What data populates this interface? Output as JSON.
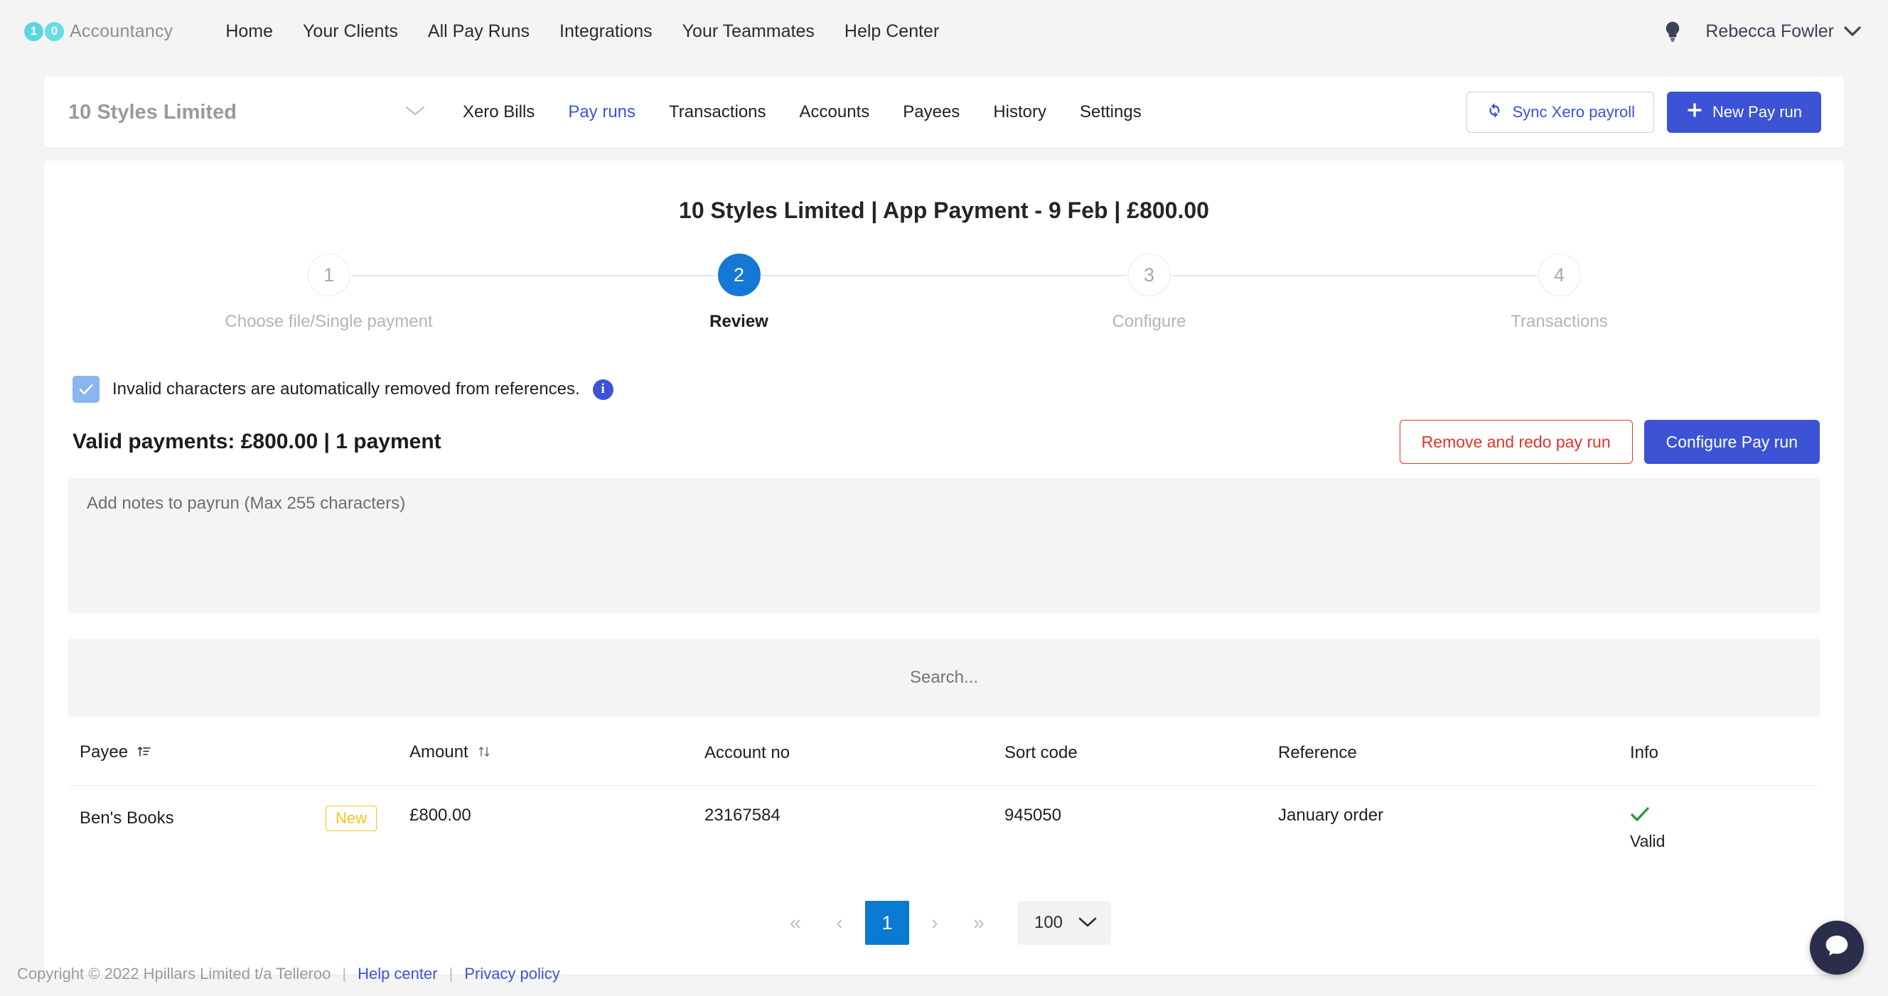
{
  "header": {
    "brand": {
      "digit_one": "1",
      "digit_zero": "0",
      "name": "Accountancy"
    },
    "nav": [
      {
        "label": "Home"
      },
      {
        "label": "Your Clients"
      },
      {
        "label": "All Pay Runs"
      },
      {
        "label": "Integrations"
      },
      {
        "label": "Your Teammates"
      },
      {
        "label": "Help Center"
      }
    ],
    "user": "Rebecca Fowler",
    "icons": {
      "bulb": "lightbulb-icon",
      "caret": "chevron-down-icon"
    }
  },
  "clientbar": {
    "client_name": "10 Styles Limited",
    "tabs": [
      {
        "label": "Xero Bills",
        "active": false
      },
      {
        "label": "Pay runs",
        "active": true
      },
      {
        "label": "Transactions",
        "active": false
      },
      {
        "label": "Accounts",
        "active": false
      },
      {
        "label": "Payees",
        "active": false
      },
      {
        "label": "History",
        "active": false
      },
      {
        "label": "Settings",
        "active": false
      }
    ],
    "sync_button": "Sync Xero payroll",
    "new_payrun_button": "New Pay run"
  },
  "main": {
    "title": "10 Styles Limited | App Payment - 9 Feb | £800.00",
    "steps": [
      {
        "number": "1",
        "label": "Choose file/Single payment",
        "active": false
      },
      {
        "number": "2",
        "label": "Review",
        "active": true
      },
      {
        "number": "3",
        "label": "Configure",
        "active": false
      },
      {
        "number": "4",
        "label": "Transactions",
        "active": false
      }
    ],
    "invalid_chars_note": "Invalid characters are automatically removed from references.",
    "info_glyph": "i",
    "valid_payments": "Valid payments: £800.00 | 1 payment",
    "remove_redo_button": "Remove and redo pay run",
    "configure_button": "Configure Pay run",
    "notes_placeholder": "Add notes to payrun (Max 255 characters)",
    "notes_value": ""
  },
  "table": {
    "search_placeholder": "Search...",
    "search_value": "",
    "columns": [
      {
        "label": "Payee",
        "sort": "sort-ascending-icon"
      },
      {
        "label": "Amount",
        "sort": "sort-updown-icon"
      },
      {
        "label": "Account no",
        "sort": ""
      },
      {
        "label": "Sort code",
        "sort": ""
      },
      {
        "label": "Reference",
        "sort": ""
      },
      {
        "label": "Info",
        "sort": ""
      }
    ],
    "rows": [
      {
        "payee": "Ben's Books",
        "badge": "New",
        "amount": "£800.00",
        "account_no": "23167584",
        "sort_code": "945050",
        "reference": "January order",
        "info_status": "Valid",
        "info_icon": "green-check-icon"
      }
    ],
    "pagination": {
      "first": "«",
      "prev": "‹",
      "current_page": "1",
      "next": "›",
      "last": "»",
      "page_size": "100"
    }
  },
  "footer": {
    "copyright": "Copyright © 2022 Hpillars Limited t/a Telleroo",
    "sep": "|",
    "help_center": "Help center",
    "privacy_policy": "Privacy policy"
  },
  "colors": {
    "brand_teal": "#5ad6dd",
    "accent_blue": "#3c53d6",
    "step_blue": "#1478d4",
    "page_blue": "#0b7ad1",
    "danger_red": "#e0342b",
    "badge_yellow": "#f5c518",
    "valid_green": "#23a03a"
  }
}
